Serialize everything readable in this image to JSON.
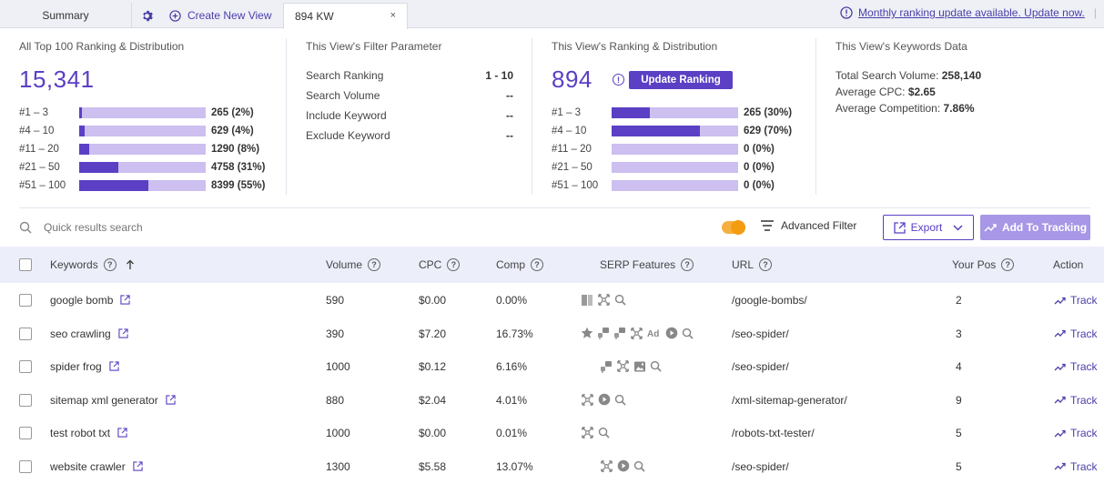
{
  "tabs": {
    "summary": "Summary",
    "create": "Create New View",
    "active": "894 KW",
    "close": "×"
  },
  "notice": {
    "link": "Monthly ranking update available. Update now.",
    "sep": "|"
  },
  "panel_all": {
    "title": "All Top 100 Ranking & Distribution",
    "total": "15,341",
    "rows": [
      {
        "label": "#1 – 3",
        "value": "265 (2%)",
        "fill": 0.02
      },
      {
        "label": "#4 – 10",
        "value": "629 (4%)",
        "fill": 0.04
      },
      {
        "label": "#11 – 20",
        "value": "1290 (8%)",
        "fill": 0.08
      },
      {
        "label": "#21 – 50",
        "value": "4758 (31%)",
        "fill": 0.31
      },
      {
        "label": "#51 – 100",
        "value": "8399 (55%)",
        "fill": 0.55
      }
    ]
  },
  "panel_filter": {
    "title": "This View's Filter Parameter",
    "rows": [
      {
        "label": "Search Ranking",
        "value": "1 - 10"
      },
      {
        "label": "Search Volume",
        "value": "--"
      },
      {
        "label": "Include Keyword",
        "value": "--"
      },
      {
        "label": "Exclude Keyword",
        "value": "--"
      }
    ]
  },
  "panel_view": {
    "title": "This View's Ranking & Distribution",
    "total": "894",
    "update_button": "Update Ranking",
    "rows": [
      {
        "label": "#1 – 3",
        "value": "265 (30%)",
        "fill": 0.3
      },
      {
        "label": "#4 – 10",
        "value": "629 (70%)",
        "fill": 0.7
      },
      {
        "label": "#11 – 20",
        "value": "0 (0%)",
        "fill": 0
      },
      {
        "label": "#21 – 50",
        "value": "0 (0%)",
        "fill": 0
      },
      {
        "label": "#51 – 100",
        "value": "0 (0%)",
        "fill": 0
      }
    ]
  },
  "panel_keywords": {
    "title": "This View's Keywords Data",
    "lines": [
      {
        "label": "Total Search Volume:",
        "value": "258,140"
      },
      {
        "label": "Average CPC:",
        "value": "$2.65"
      },
      {
        "label": "Average Competition:",
        "value": "7.86%"
      }
    ]
  },
  "toolbar": {
    "search_placeholder": "Quick results search",
    "advanced_filter": "Advanced Filter",
    "export": "Export",
    "add_tracking": "Add To Tracking"
  },
  "table": {
    "headers": {
      "keywords": "Keywords",
      "volume": "Volume",
      "cpc": "CPC",
      "comp": "Comp",
      "serp": "SERP Features",
      "url": "URL",
      "pos": "Your Pos",
      "action": "Action"
    },
    "track_label": "Track",
    "rows": [
      {
        "keyword": "google bomb",
        "volume": "590",
        "cpc": "$0.00",
        "comp": "0.00%",
        "serp": [
          "panel-icon",
          "expand-icon",
          "search-icon"
        ],
        "url": "/google-bombs/",
        "pos": "2"
      },
      {
        "keyword": "seo crawling",
        "volume": "390",
        "cpc": "$7.20",
        "comp": "16.73%",
        "serp": [
          "star-icon",
          "qa-icon",
          "qa-icon",
          "expand-icon",
          "ad-icon",
          "video-icon",
          "search-icon"
        ],
        "url": "/seo-spider/",
        "pos": "3"
      },
      {
        "keyword": "spider frog",
        "volume": "1000",
        "cpc": "$0.12",
        "comp": "6.16%",
        "serp": [
          "qa-icon",
          "expand-icon",
          "image-icon",
          "search-icon"
        ],
        "url": "/seo-spider/",
        "pos": "4"
      },
      {
        "keyword": "sitemap xml generator",
        "volume": "880",
        "cpc": "$2.04",
        "comp": "4.01%",
        "serp": [
          "expand-icon",
          "video-icon",
          "search-icon"
        ],
        "url": "/xml-sitemap-generator/",
        "pos": "9"
      },
      {
        "keyword": "test robot txt",
        "volume": "1000",
        "cpc": "$0.00",
        "comp": "0.01%",
        "serp": [
          "expand-icon",
          "search-icon"
        ],
        "url": "/robots-txt-tester/",
        "pos": "5"
      },
      {
        "keyword": "website crawler",
        "volume": "1300",
        "cpc": "$5.58",
        "comp": "13.07%",
        "serp": [
          "expand-icon",
          "video-icon",
          "search-icon"
        ],
        "url": "/seo-spider/",
        "pos": "5"
      }
    ]
  },
  "colors": {
    "accent": "#5b3fc4",
    "bar_bg": "#cdbff0",
    "toggle": "#f39c12"
  }
}
